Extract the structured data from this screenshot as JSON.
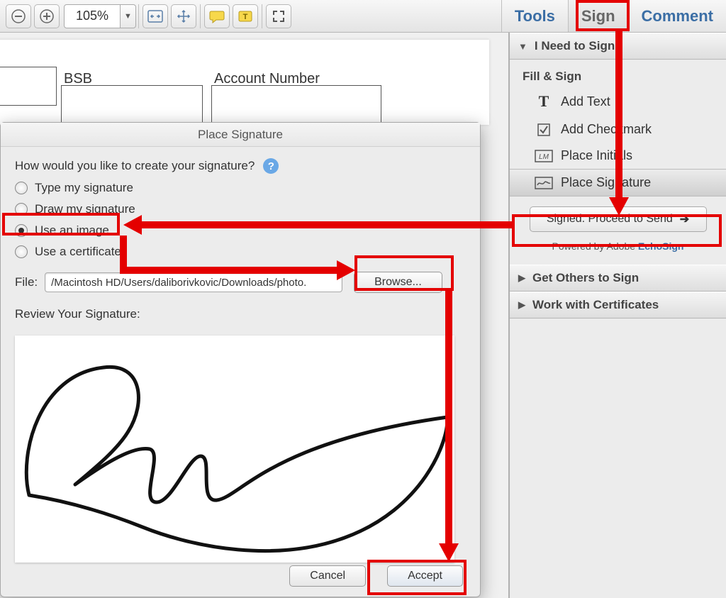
{
  "toolbar": {
    "zoom_value": "105%"
  },
  "right_tabs": {
    "tools": "Tools",
    "sign": "Sign",
    "comment": "Comment"
  },
  "doc_fields": {
    "bsb": "BSB",
    "account_number": "Account Number"
  },
  "side": {
    "need_to_sign": "I Need to Sign",
    "fill_sign": "Fill & Sign",
    "add_text": "Add Text",
    "add_checkmark": "Add Checkmark",
    "place_initials": "Place Initials",
    "place_signature": "Place Signature",
    "proceed": "Signed. Proceed to Send",
    "powered_prefix": "Powered by Adobe ",
    "powered_link": "EchoSign",
    "get_others": "Get Others to Sign",
    "work_certs": "Work with Certificates"
  },
  "dialog": {
    "title": "Place Signature",
    "question": "How would you like to create your signature?",
    "opt_type": "Type my signature",
    "opt_draw": "Draw my signature",
    "opt_image": "Use an image",
    "opt_cert": "Use a certificate",
    "file_label": "File:",
    "file_path": "/Macintosh HD/Users/daliborivkovic/Downloads/photo.",
    "browse": "Browse...",
    "review": "Review Your Signature:",
    "cancel": "Cancel",
    "accept": "Accept"
  }
}
